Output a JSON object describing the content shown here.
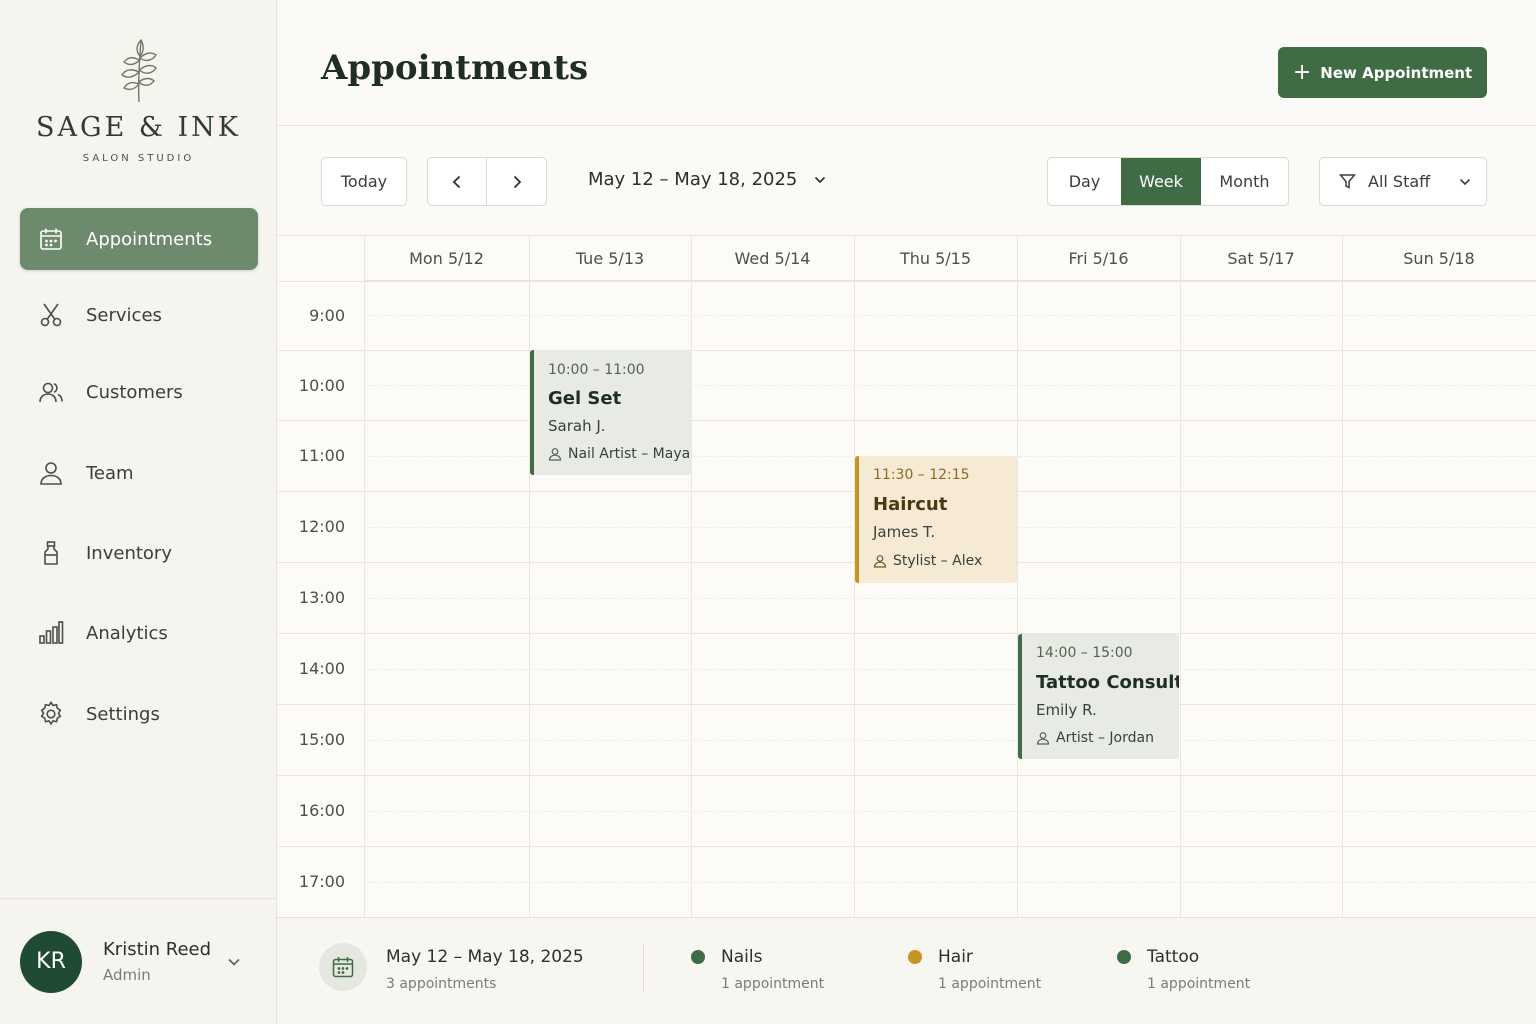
{
  "brand": {
    "name": "SAGE & INK",
    "tagline": "SALON STUDIO"
  },
  "sidebar": {
    "items": [
      {
        "label": "Appointments",
        "icon": "calendar-icon",
        "active": true
      },
      {
        "label": "Services",
        "icon": "scissors-icon"
      },
      {
        "label": "Customers",
        "icon": "users-icon"
      },
      {
        "label": "Team",
        "icon": "user-icon"
      },
      {
        "label": "Inventory",
        "icon": "bottle-icon"
      },
      {
        "label": "Analytics",
        "icon": "bar-chart-icon"
      },
      {
        "label": "Settings",
        "icon": "gear-icon"
      }
    ]
  },
  "user": {
    "initials": "KR",
    "name": "Kristin Reed",
    "role": "Admin"
  },
  "header": {
    "title": "Appointments",
    "new_button": "New Appointment"
  },
  "toolbar": {
    "today": "Today",
    "date_range": "May 12 – May 18, 2025",
    "views": [
      "Day",
      "Week",
      "Month"
    ],
    "active_view": "Week",
    "staff_filter": "All Staff"
  },
  "calendar": {
    "days": [
      "Mon 5/12",
      "Tue 5/13",
      "Wed 5/14",
      "Thu 5/15",
      "Fri 5/16",
      "Sat 5/17",
      "Sun 5/18"
    ],
    "hours": [
      "9:00",
      "10:00",
      "11:00",
      "12:00",
      "13:00",
      "14:00",
      "15:00",
      "16:00",
      "17:00"
    ],
    "events": [
      {
        "time": "10:00 – 11:00",
        "title": "Gel Set",
        "client": "Sarah J.",
        "staff": "Nail Artist – Maya",
        "category": "Nails"
      },
      {
        "time": "11:30 – 12:15",
        "title": "Haircut",
        "client": "James T.",
        "staff": "Stylist – Alex",
        "category": "Hair"
      },
      {
        "time": "14:00 – 15:00",
        "title": "Tattoo Consult",
        "client": "Emily R.",
        "staff": "Artist – Jordan",
        "category": "Tattoo"
      }
    ]
  },
  "summary": {
    "range": "May 12 – May 18, 2025",
    "count": "3 appointments",
    "categories": [
      {
        "name": "Nails",
        "count": "1 appointment",
        "color": "#3f6b45"
      },
      {
        "name": "Hair",
        "count": "1 appointment",
        "color": "#c6951f"
      },
      {
        "name": "Tattoo",
        "count": "1 appointment",
        "color": "#3f6b45"
      }
    ]
  },
  "colors": {
    "primary": "#3f6b45",
    "active_nav": "#6e8a6d",
    "hair_accent": "#c6951f",
    "avatar": "#1f4a33"
  }
}
